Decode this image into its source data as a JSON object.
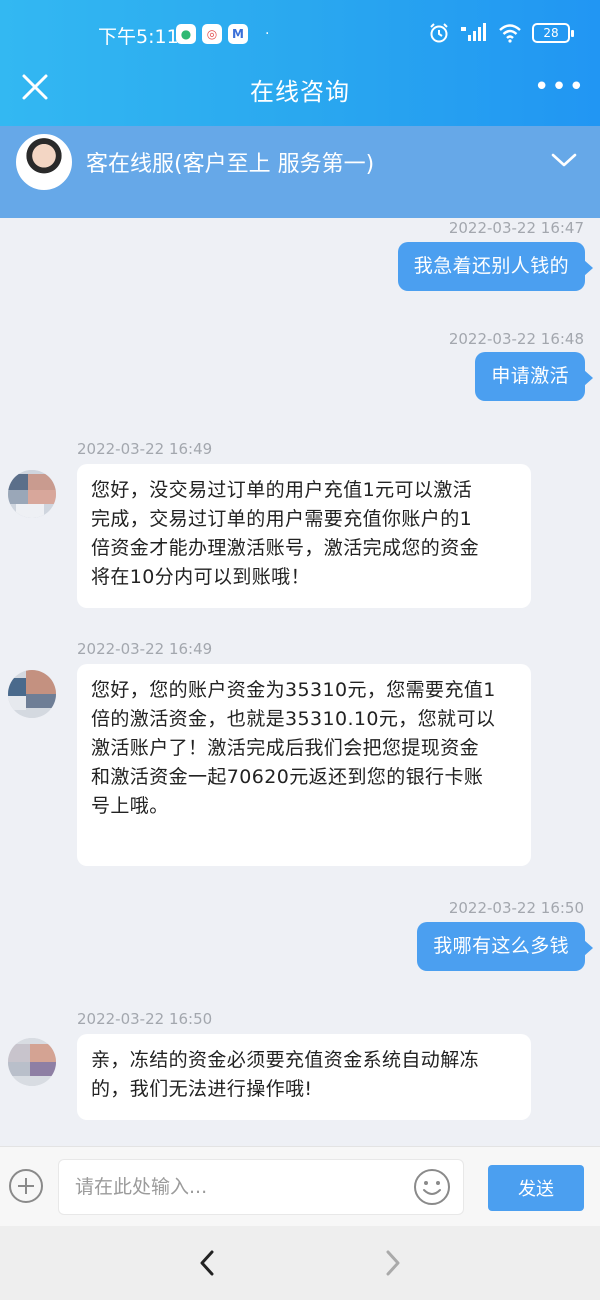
{
  "status": {
    "time": "下午5:11",
    "dot": "·",
    "battery": "28"
  },
  "nav": {
    "title": "在线咨询"
  },
  "agent": {
    "name": "客在线服(客户至上 服务第一)"
  },
  "messages": [
    {
      "side": "right",
      "time": "2022-03-22 16:47",
      "text": "我急着还别人钱的"
    },
    {
      "side": "right",
      "time": "2022-03-22 16:48",
      "text": "申请激活"
    },
    {
      "side": "left",
      "time": "2022-03-22 16:49",
      "lines": [
        "您好，没交易过订单的用户充值1元可以激活",
        "完成，交易过订单的用户需要充值你账户的1",
        "倍资金才能办理激活账号，激活完成您的资金",
        "将在10分内可以到账哦！"
      ]
    },
    {
      "side": "left",
      "time": "2022-03-22 16:49",
      "lines": [
        "您好，您的账户资金为35310元，您需要充值1",
        "倍的激活资金，也就是35310.10元，您就可以",
        "激活账户了！激活完成后我们会把您提现资金",
        "和激活资金一起70620元返还到您的银行卡账",
        "号上哦。"
      ]
    },
    {
      "side": "right",
      "time": "2022-03-22 16:50",
      "text": "我哪有这么多钱"
    },
    {
      "side": "left",
      "time": "2022-03-22 16:50",
      "lines": [
        "亲，冻结的资金必须要充值资金系统自动解冻",
        "的，我们无法进行操作哦!"
      ]
    }
  ],
  "input": {
    "placeholder": "请在此处输入...",
    "send_label": "发送"
  },
  "colors": {
    "header": "#2aa8ef",
    "agent_bar": "#66a8e8",
    "bubble_right": "#4b9ff0",
    "bubble_left": "#ffffff",
    "background": "#eef0f5"
  },
  "icons": [
    "close-icon",
    "more-icon",
    "chevron-down-icon",
    "plus-icon",
    "emoji-icon",
    "back-icon",
    "forward-icon"
  ]
}
